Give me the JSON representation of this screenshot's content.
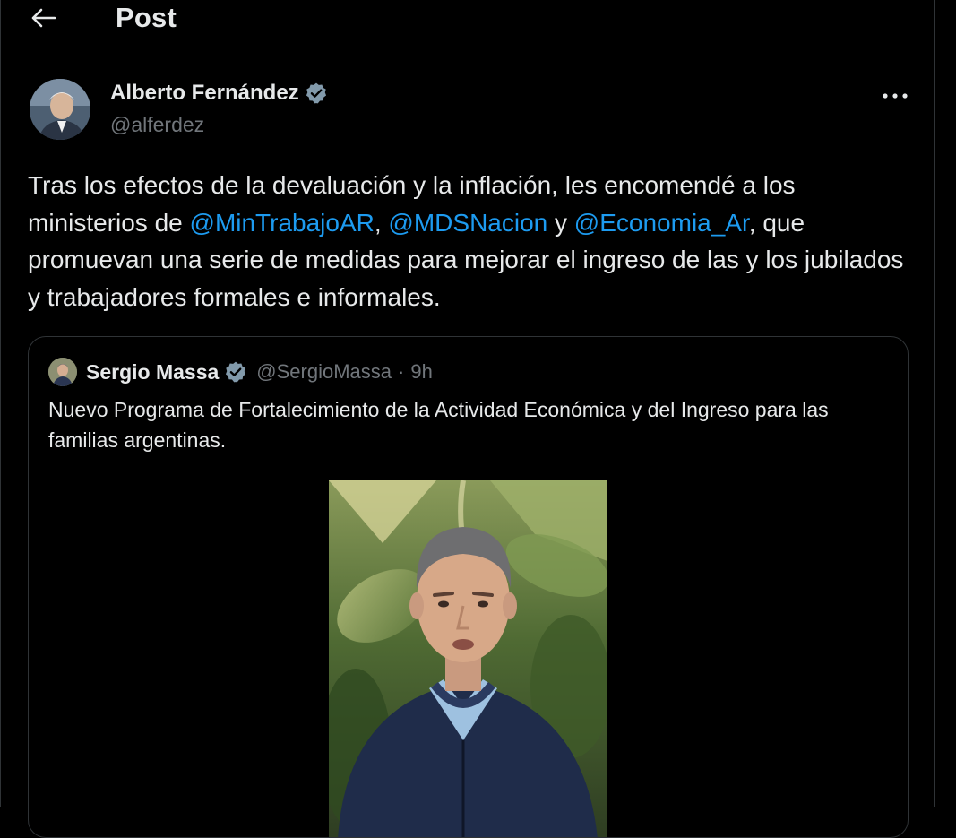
{
  "header": {
    "title": "Post",
    "back_icon": "arrow-left-icon"
  },
  "post": {
    "author_name": "Alberto Fernández",
    "author_handle": "@alferdez",
    "verified_icon": "verified-badge-icon",
    "more_icon": "more-horizontal-icon",
    "text_1": "Tras los efectos de la devaluación y la inflación, les encomendé a los ministerios de ",
    "mention_1": "@MinTrabajoAR",
    "text_2": ", ",
    "mention_2": "@MDSNacion",
    "text_3": " y ",
    "mention_3": "@Economia_Ar",
    "text_4": ", que promuevan una serie de medidas para mejorar el ingreso de las y los jubilados y trabajadores formales e informales."
  },
  "quoted": {
    "author_name": "Sergio Massa",
    "author_handle": "@SergioMassa",
    "separator": "·",
    "time": "9h",
    "text": "Nuevo Programa de Fortalecimiento de la Actividad Económica y del Ingreso para las familias argentinas."
  },
  "colors": {
    "background": "#000000",
    "text": "#e7e9ea",
    "secondary": "#71767b",
    "accent": "#1d9bf0",
    "border": "#2f3336",
    "verified": "#829aab"
  }
}
